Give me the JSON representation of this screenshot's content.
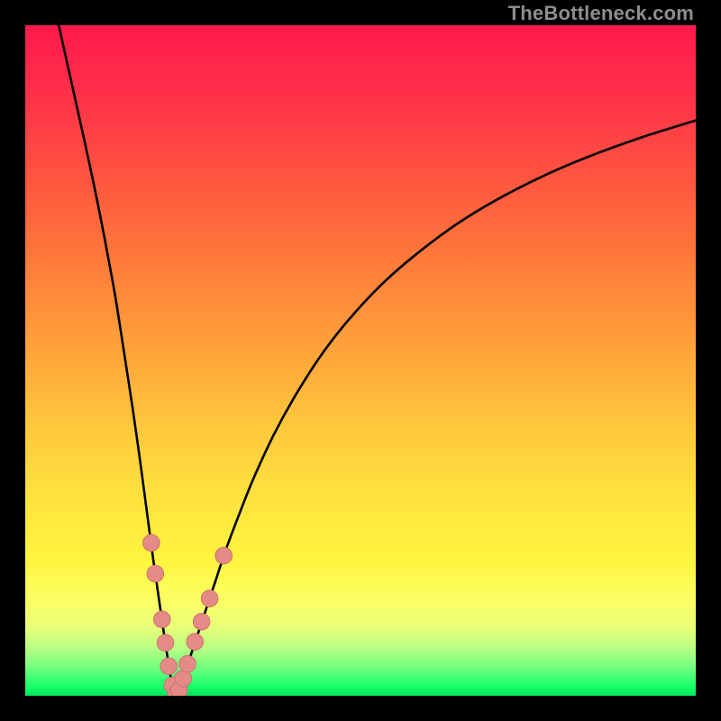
{
  "watermark": "TheBottleneck.com",
  "colors": {
    "background": "#000000",
    "curve": "#000000",
    "marker_fill": "#e58a86",
    "marker_stroke": "#c96f6b"
  },
  "gradient_stops": [
    {
      "offset": 0.0,
      "color": "#ff1a4d"
    },
    {
      "offset": 0.1,
      "color": "#ff2f49"
    },
    {
      "offset": 0.22,
      "color": "#ff5340"
    },
    {
      "offset": 0.35,
      "color": "#ff7a3a"
    },
    {
      "offset": 0.48,
      "color": "#ffa23a"
    },
    {
      "offset": 0.6,
      "color": "#ffc83c"
    },
    {
      "offset": 0.72,
      "color": "#ffe63e"
    },
    {
      "offset": 0.8,
      "color": "#fff53f"
    },
    {
      "offset": 0.86,
      "color": "#fbff66"
    },
    {
      "offset": 0.9,
      "color": "#e6ff7a"
    },
    {
      "offset": 0.93,
      "color": "#b7ff82"
    },
    {
      "offset": 0.96,
      "color": "#6dff7f"
    },
    {
      "offset": 0.985,
      "color": "#1aff6a"
    },
    {
      "offset": 1.0,
      "color": "#00e65a"
    }
  ],
  "chart_data": {
    "type": "line",
    "title": "",
    "xlabel": "",
    "ylabel": "",
    "xlim": [
      0,
      100
    ],
    "ylim": [
      0,
      100
    ],
    "series": [
      {
        "name": "left-branch",
        "x": [
          5,
          7,
          9,
          11,
          13,
          14,
          15,
          16,
          17,
          18,
          19,
          20,
          20.8,
          21.4,
          21.8,
          22.1,
          22.35,
          22.5
        ],
        "y": [
          100,
          91,
          82,
          72.5,
          62,
          56,
          49.5,
          43,
          36,
          28.5,
          21,
          14,
          8.5,
          4.5,
          2.2,
          1.0,
          0.3,
          0.05
        ]
      },
      {
        "name": "right-branch",
        "x": [
          22.5,
          22.7,
          23.1,
          23.8,
          24.6,
          25.6,
          26.8,
          28.4,
          30,
          32,
          34,
          37,
          40,
          44,
          48,
          53,
          58,
          64,
          70,
          77,
          84,
          92,
          100
        ],
        "y": [
          0.05,
          0.4,
          1.4,
          3.3,
          5.8,
          8.8,
          12.4,
          17.2,
          22,
          27.3,
          32.3,
          38.8,
          44.3,
          50.6,
          55.8,
          61.2,
          65.6,
          70.1,
          73.8,
          77.4,
          80.4,
          83.3,
          85.8
        ]
      }
    ],
    "markers": [
      {
        "x": 18.8,
        "y": 22.8
      },
      {
        "x": 19.4,
        "y": 18.2
      },
      {
        "x": 20.4,
        "y": 11.4
      },
      {
        "x": 20.9,
        "y": 7.9
      },
      {
        "x": 21.4,
        "y": 4.4
      },
      {
        "x": 21.95,
        "y": 1.55
      },
      {
        "x": 22.45,
        "y": 0.2
      },
      {
        "x": 22.95,
        "y": 0.8
      },
      {
        "x": 23.55,
        "y": 2.6
      },
      {
        "x": 24.2,
        "y": 4.75
      },
      {
        "x": 25.3,
        "y": 8.05
      },
      {
        "x": 26.3,
        "y": 11.05
      },
      {
        "x": 27.5,
        "y": 14.5
      },
      {
        "x": 29.6,
        "y": 20.9
      }
    ],
    "marker_radius": 1.25
  }
}
